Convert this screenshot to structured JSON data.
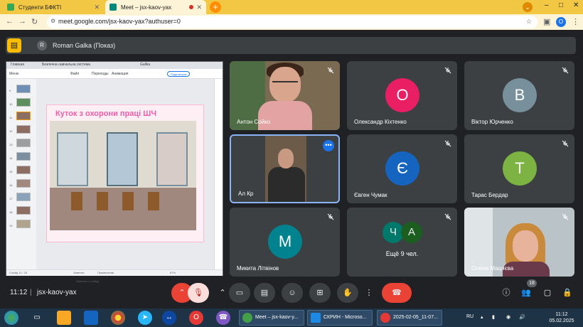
{
  "browser": {
    "tabs": [
      {
        "label": "Студенти БФКТІ"
      },
      {
        "label": "Meet – jsx-kaov-yax"
      }
    ],
    "url": "meet.google.com/jsx-kaov-yax?authuser=0",
    "profile_initial": "O",
    "win_minimize": "–",
    "win_maximize": "□",
    "win_close": "✕"
  },
  "presenter": {
    "initial": "R",
    "label": "Roman Galka (Показ)"
  },
  "presentation": {
    "tabs": [
      "Главная",
      "Безпечна навчальна система",
      "Gallka"
    ],
    "ribbon": [
      "Меню",
      "Файл",
      "Переходы",
      "Анимация"
    ],
    "share_label": "Поделиться",
    "slide_numbers": [
      "9",
      "10",
      "11",
      "12",
      "13",
      "14",
      "15",
      "16",
      "17",
      "18",
      "19"
    ],
    "slide_title": "Куток з охорони праці ШЧ",
    "notes_placeholder": "Заметки к слайду",
    "status_left": "Слайд 11 / 25",
    "status_notes": "Заметки",
    "status_comments": "Примечания",
    "zoom": "87%"
  },
  "participants": [
    {
      "name": "Антон Сойко",
      "type": "video",
      "muted": true
    },
    {
      "name": "Олександр Кіхтенко",
      "initial": "О",
      "color": "#e91e63",
      "muted": true
    },
    {
      "name": "Віктор Юрченко",
      "initial": "В",
      "color": "#78909c",
      "muted": true
    },
    {
      "name": "Ал Кр",
      "type": "video",
      "muted": false,
      "more": "•••"
    },
    {
      "name": "Євген Чумак",
      "initial": "Є",
      "color": "#1565c0",
      "muted": true
    },
    {
      "name": "Тарас Бердар",
      "initial": "Т",
      "color": "#7cb342",
      "muted": true
    },
    {
      "name": "Микита Літвінов",
      "initial": "М",
      "color": "#00838f",
      "muted": true
    },
    {
      "name": "Ещё 9 чел.",
      "type": "more",
      "initials": [
        "Ч",
        "А"
      ],
      "muted": true
    },
    {
      "name": "Олена Мацнєва",
      "type": "video",
      "muted": true
    }
  ],
  "controls": {
    "time": "11:12",
    "separator": "|",
    "meeting_code": "jsx-kaov-yax",
    "participant_count": "18"
  },
  "taskbar": {
    "tasks": [
      {
        "label": "Meet – jsx-kaov-y..."
      },
      {
        "label": "СКРИН - Microso..."
      },
      {
        "label": "2025-02-05_11-07..."
      }
    ],
    "lang": "RU",
    "clock_time": "11:12",
    "clock_date": "05.02.2025"
  }
}
